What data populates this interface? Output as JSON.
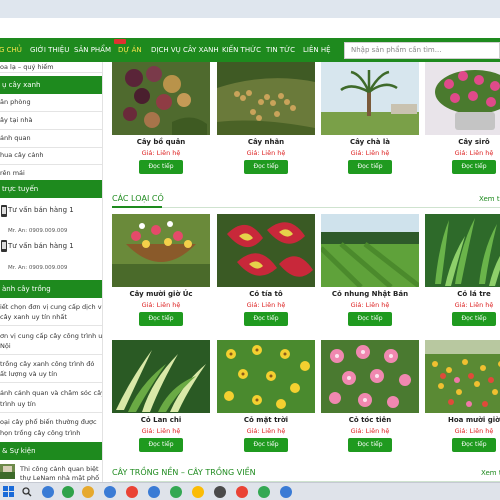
{
  "nav": {
    "items": [
      {
        "label": "G CHỦ",
        "active": true
      },
      {
        "label": "GIỚI THIỆU",
        "active": false
      },
      {
        "label": "SẢN PHẨM",
        "active": false
      },
      {
        "label": "DỰ ÁN",
        "active": true
      },
      {
        "label": "DỊCH VỤ CÂY XANH",
        "active": false
      },
      {
        "label": "KIẾN THỨC",
        "active": false
      },
      {
        "label": "TIN TỨC",
        "active": false
      },
      {
        "label": "LIÊN HỆ",
        "active": false
      }
    ],
    "search_placeholder": "Nhập sản phẩm cần tìm..."
  },
  "sidebar": {
    "top_item": "oa lạ – quý hiếm",
    "service_heading": "ụ cây xanh",
    "service_items": [
      "ăn phòng",
      "ây tại nhà",
      "ảnh quan",
      "hua cây cảnh",
      "rên mái"
    ],
    "support_heading": "trực tuyến",
    "supporters": [
      {
        "name": "Tư vấn bán hàng 1",
        "phone": "Mr. An: 0909.009.009"
      },
      {
        "name": "Tư vấn bán hàng 1",
        "phone": "Mr. An: 0909.009.009"
      }
    ],
    "news_heading": "ành cây trồng",
    "news_items": [
      [
        "iết chọn đơn vị cung cấp dịch vụ",
        "cây xanh uy tín nhất"
      ],
      [
        "ơn vị cung cấp cây công trình uy tín",
        " Nội"
      ],
      [
        "trồng cây xanh công trình đó",
        "ất lượng và uy tín"
      ],
      [
        "ảnh cảnh quan và chăm sóc cây",
        "trình uy tín"
      ],
      [
        "oại cây phổ biến thường được",
        "họn trồng cây công trình"
      ]
    ],
    "events_heading": "& Sự kiện",
    "events_items": [
      [
        "Thi công cảnh quan biệt",
        "thự LeNam nhà mặt phố"
      ]
    ]
  },
  "main": {
    "top_row": [
      {
        "name": "Cây bồ quân",
        "price": "Giá: Liên hệ",
        "button": "Đọc tiếp",
        "image": "purple-berries"
      },
      {
        "name": "Cây nhãn",
        "price": "Giá: Liên hệ",
        "button": "Đọc tiếp",
        "image": "longan-fruit"
      },
      {
        "name": "Cây chà là",
        "price": "Giá: Liên hệ",
        "button": "Đọc tiếp",
        "image": "date-palm"
      },
      {
        "name": "Cây sirô",
        "price": "Giá: Liên hệ",
        "button": "Đọc tiếp",
        "image": "pink-flower-basket"
      }
    ],
    "grass_section": {
      "title": "CÁC LOẠI CỎ",
      "view_all": "Xem tấ",
      "products": [
        {
          "name": "Cây mười giờ Úc",
          "price": "Giá: Liên hệ",
          "button": "Đọc tiếp",
          "image": "hanging-flower-basket"
        },
        {
          "name": "Cỏ tía tô",
          "price": "Giá: Liên hệ",
          "button": "Đọc tiếp",
          "image": "coleus-leaves"
        },
        {
          "name": "Cỏ nhung Nhật Bản",
          "price": "Giá: Liên hệ",
          "button": "Đọc tiếp",
          "image": "lawn"
        },
        {
          "name": "Cỏ lá tre",
          "price": "Giá: Liên hệ",
          "button": "Đọc tiếp",
          "image": "bamboo-grass"
        },
        {
          "name": "Cỏ Lan chi",
          "price": "Giá: Liên hệ",
          "button": "Đọc tiếp",
          "image": "spider-plant"
        },
        {
          "name": "Cỏ mặt trời",
          "price": "Giá: Liên hệ",
          "button": "Đọc tiếp",
          "image": "yellow-flowers"
        },
        {
          "name": "Cỏ tóc tiên",
          "price": "Giá: Liên hệ",
          "button": "Đọc tiếp",
          "image": "pink-rain-lilies"
        },
        {
          "name": "Hoa mười giờ",
          "price": "Giá: Liên hệ",
          "button": "Đọc tiếp",
          "image": "portulaca-field"
        }
      ]
    },
    "next_section": {
      "title": "CÂY TRỒNG NỀN – CÂY TRỒNG VIỀN",
      "view_all": "Xem t"
    }
  },
  "taskbar": {
    "icons": [
      "start-icon",
      "search-icon",
      "app-icon",
      "app-icon",
      "app-icon",
      "app-icon",
      "app-icon",
      "app-icon",
      "app-icon",
      "app-icon",
      "app-icon",
      "app-icon",
      "app-icon",
      "app-icon"
    ]
  },
  "colors": {
    "brand_green": "#1e8a1e",
    "price_red": "#d22222",
    "nav_active": "#f6e34a"
  }
}
